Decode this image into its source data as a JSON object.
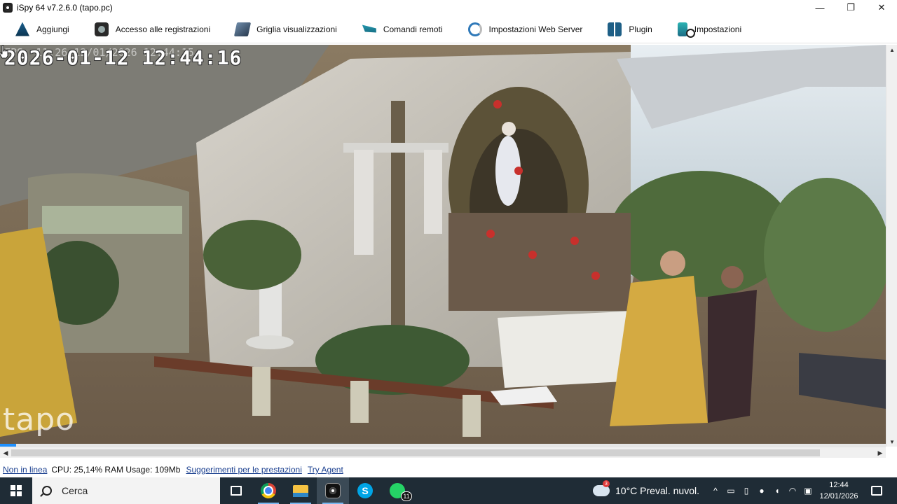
{
  "window": {
    "title": "iSpy 64 v7.2.6.0 (tapo.pc)",
    "minimize": "—",
    "maximize": "❐",
    "close": "✕"
  },
  "toolbar": {
    "items": [
      {
        "label": "Aggiungi",
        "icon": "add-icon"
      },
      {
        "label": "Accesso alle registrazioni",
        "icon": "recordings-icon"
      },
      {
        "label": "Griglia visualizzazioni",
        "icon": "grid-icon"
      },
      {
        "label": "Comandi remoti",
        "icon": "remote-icon"
      },
      {
        "label": "Impostazioni Web Server",
        "icon": "webserver-icon"
      },
      {
        "label": "Plugin",
        "icon": "plugin-icon"
      },
      {
        "label": "Impostazioni",
        "icon": "settings-icon"
      }
    ]
  },
  "camera": {
    "timestamp": "2026-01-12 12:44:16",
    "fps_overlay": "FPS: 11.26 12/01/2026 12:44:15",
    "watermark": "tapo",
    "playback_progress": 0.018
  },
  "statusbar": {
    "offline_link": "Non in linea",
    "stats": "CPU: 25,14% RAM Usage: 109Mb",
    "tips_link": "Suggerimenti per le prestazioni",
    "agent_link": "Try Agent"
  },
  "taskbar": {
    "search_placeholder": "Cerca",
    "skype_letter": "S",
    "whatsapp_badge": "11",
    "weather_badge": "3",
    "weather": "10°C  Preval. nuvol.",
    "time": "12:44",
    "date": "12/01/2026"
  },
  "colors": {
    "taskbar": "#1f2c36",
    "link": "#1a3f8f",
    "progress": "#1e90ff"
  }
}
